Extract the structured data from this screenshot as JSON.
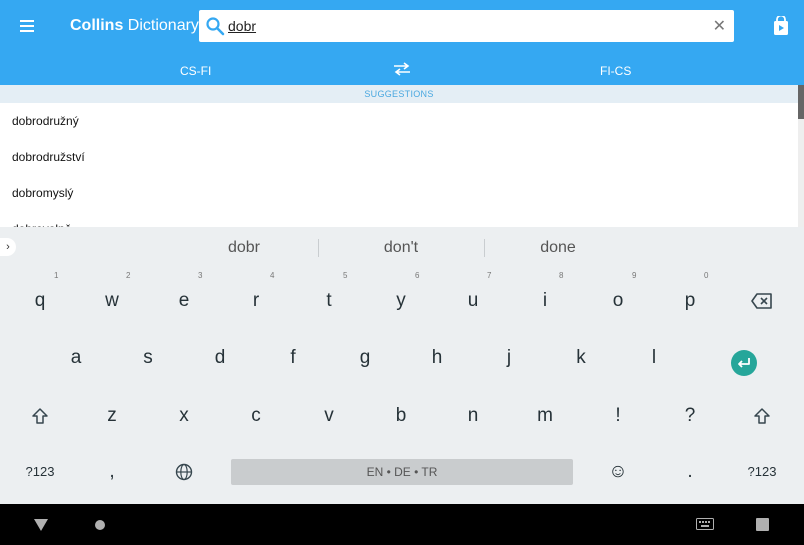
{
  "app": {
    "title_bold": "Collins",
    "title_rest": " Dictionary",
    "menu_icon": "hamburger-menu-icon",
    "store_icon": "play-store-icon"
  },
  "search": {
    "query": "dobr",
    "clear_label": "✕"
  },
  "tabs": {
    "left": "CS-FI",
    "right": "FI-CS"
  },
  "suggestions": {
    "header": "SUGGESTIONS",
    "items": [
      "dobrodružný",
      "dobrodružství",
      "dobromyslý",
      "dobrovolně"
    ]
  },
  "keyboard": {
    "strip_arrow": "›",
    "suggest_words": [
      "dobr",
      "don't",
      "done"
    ],
    "row1": [
      {
        "label": "q",
        "hint": "1"
      },
      {
        "label": "w",
        "hint": "2"
      },
      {
        "label": "e",
        "hint": "3"
      },
      {
        "label": "r",
        "hint": "4"
      },
      {
        "label": "t",
        "hint": "5"
      },
      {
        "label": "y",
        "hint": "6"
      },
      {
        "label": "u",
        "hint": "7"
      },
      {
        "label": "i",
        "hint": "8"
      },
      {
        "label": "o",
        "hint": "9"
      },
      {
        "label": "p",
        "hint": "0"
      }
    ],
    "row2": [
      "a",
      "s",
      "d",
      "f",
      "g",
      "h",
      "j",
      "k",
      "l"
    ],
    "row3": [
      "z",
      "x",
      "c",
      "v",
      "b",
      "n",
      "m",
      "!",
      "?"
    ],
    "symbols_label": "?123",
    "comma": ",",
    "period": ".",
    "space_label": "EN • DE • TR",
    "emoji_symbol": "☺"
  },
  "colors": {
    "appbar": "#35a8f2",
    "accent_enter": "#26a69a",
    "suggestion_header_text": "#4aa8e0"
  }
}
